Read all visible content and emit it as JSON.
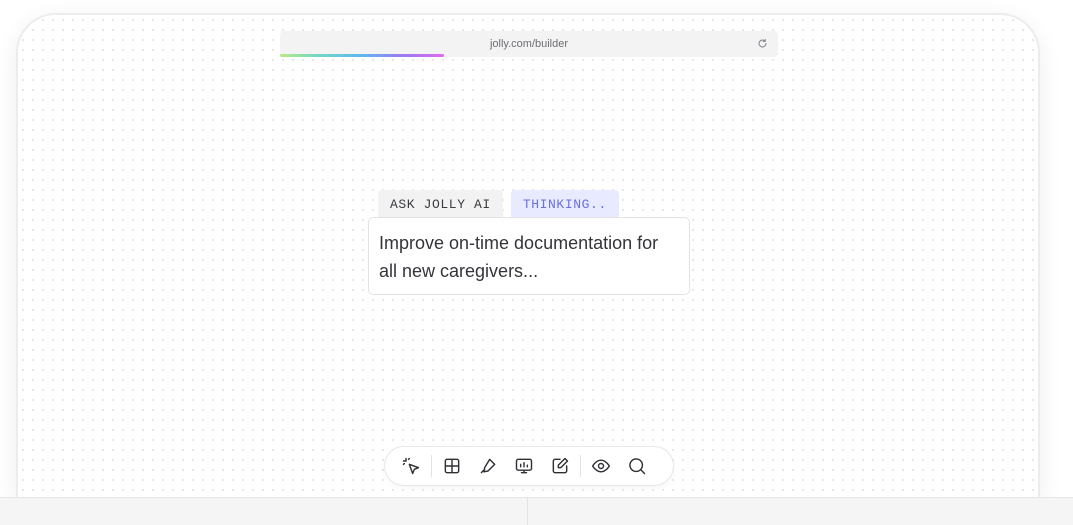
{
  "browser": {
    "url": "jolly.com/builder",
    "refresh_icon": "refresh-icon",
    "load_progress_percent": 33
  },
  "prompt": {
    "tab_ask_label": "ASK JOLLY AI",
    "tab_status_label": "THINKING..",
    "text": "Improve on-time documentation for all new caregivers..."
  },
  "toolbar": {
    "tools": [
      {
        "name": "select-ai-icon"
      },
      {
        "name": "layout-icon"
      },
      {
        "name": "pen-icon"
      },
      {
        "name": "presentation-icon"
      },
      {
        "name": "edit-icon"
      },
      {
        "name": "preview-eye-icon"
      },
      {
        "name": "search-icon"
      }
    ]
  },
  "colors": {
    "accent": "#6a6fe0",
    "accent_bg": "#e8ebff",
    "text": "#34343a"
  }
}
